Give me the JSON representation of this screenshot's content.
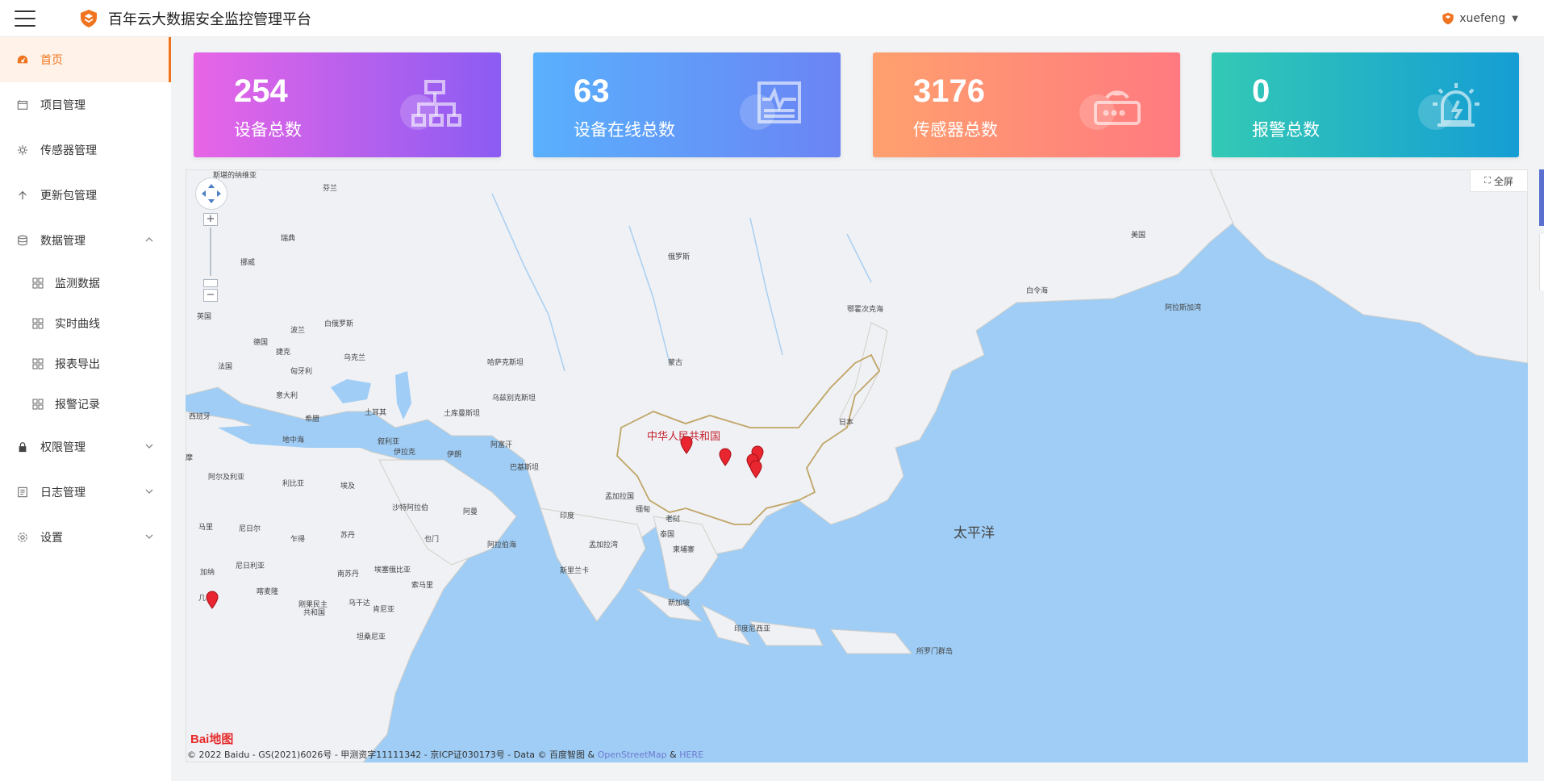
{
  "app": {
    "title": "百年云大数据安全监控管理平台"
  },
  "user": {
    "name": "xuefeng"
  },
  "sidebar": {
    "items": [
      {
        "label": "首页",
        "icon": "dashboard-icon",
        "active": true
      },
      {
        "label": "项目管理",
        "icon": "project-icon"
      },
      {
        "label": "传感器管理",
        "icon": "sensor-icon"
      },
      {
        "label": "更新包管理",
        "icon": "upload-icon"
      },
      {
        "label": "数据管理",
        "icon": "database-icon",
        "expanded": true
      },
      {
        "label": "权限管理",
        "icon": "lock-icon"
      },
      {
        "label": "日志管理",
        "icon": "log-icon"
      },
      {
        "label": "设置",
        "icon": "settings-icon"
      }
    ],
    "data_sub": [
      {
        "label": "监测数据"
      },
      {
        "label": "实时曲线"
      },
      {
        "label": "报表导出"
      },
      {
        "label": "报警记录"
      }
    ]
  },
  "stats": [
    {
      "value": "254",
      "label": "设备总数",
      "icon": "network-icon",
      "color_from": "#e865e6",
      "color_to": "#8b5cf3"
    },
    {
      "value": "63",
      "label": "设备在线总数",
      "icon": "monitor-icon",
      "color_from": "#59b0fd",
      "color_to": "#6b84f4"
    },
    {
      "value": "3176",
      "label": "传感器总数",
      "icon": "router-icon",
      "color_from": "#ffa06e",
      "color_to": "#ff7a80"
    },
    {
      "value": "0",
      "label": "报警总数",
      "icon": "alarm-icon",
      "color_from": "#33c9b5",
      "color_to": "#159dd4"
    }
  ],
  "map": {
    "fullscreen_label": "全屏",
    "zoom_in": "+",
    "zoom_out": "−",
    "labels": {
      "finland": "芬兰",
      "sweden": "瑞典",
      "norway": "挪威",
      "uk": "英国",
      "belarus": "白俄罗斯",
      "poland": "波兰",
      "germany": "德国",
      "czech": "捷克",
      "ukraine": "乌克兰",
      "france": "法国",
      "hungary": "匈牙利",
      "italy": "意大利",
      "spain": "西班牙",
      "greece": "希腊",
      "turkey": "土耳其",
      "russia": "俄罗斯",
      "kazakhstan": "哈萨克斯坦",
      "mongolia": "蒙古",
      "uzbekistan": "乌兹别克斯坦",
      "turkmenistan": "土库曼斯坦",
      "syria": "叙利亚",
      "iraq": "伊拉克",
      "iran": "伊朗",
      "afghanistan": "阿富汗",
      "pakistan": "巴基斯坦",
      "china": "中华人民共和国",
      "japan": "日本",
      "bering": "白令海",
      "okhotsk": "鄂霍次克海",
      "usa": "美国",
      "alaska": "阿拉斯加湾",
      "pacific": "太平洋",
      "india": "印度",
      "bangladesh": "孟加拉国",
      "myanmar": "缅甸",
      "laos": "老挝",
      "thailand": "泰国",
      "cambodia": "柬埔寨",
      "srilanka": "斯里兰卡",
      "singapore": "新加坡",
      "indonesia": "印度尼西亚",
      "papua": "所罗门群岛",
      "bengal": "孟加拉湾",
      "arabian": "阿拉伯海",
      "mediterranean": "地中海",
      "algeria": "阿尔及利亚",
      "libya": "利比亚",
      "egypt": "埃及",
      "saudi": "沙特阿拉伯",
      "oman": "阿曼",
      "yemen": "也门",
      "mali": "马里",
      "niger": "尼日尔",
      "chad": "乍得",
      "sudan": "苏丹",
      "nigeria": "尼日利亚",
      "ethiopia": "埃塞俄比亚",
      "somalia": "索马里",
      "southsudan": "南苏丹",
      "cameroon": "喀麦隆",
      "gabon": "加纳",
      "drc": "刚果民主",
      "drc2": "共和国",
      "uganda": "乌干达",
      "kenya": "肯尼亚",
      "tanzania": "坦桑尼亚",
      "morocco": "摩",
      "ghana": "几"
    },
    "copyright_text": "© 2022 Baidu - GS(2021)6026号 - 甲测资字11111342 - 京ICP证030173号 - Data © 百度智图 &",
    "osm_link": "OpenStreetMap",
    "amp": "&",
    "here_link": "HERE",
    "baidu_logo": "Bai地图",
    "top_label": "斯堪的纳维亚"
  }
}
